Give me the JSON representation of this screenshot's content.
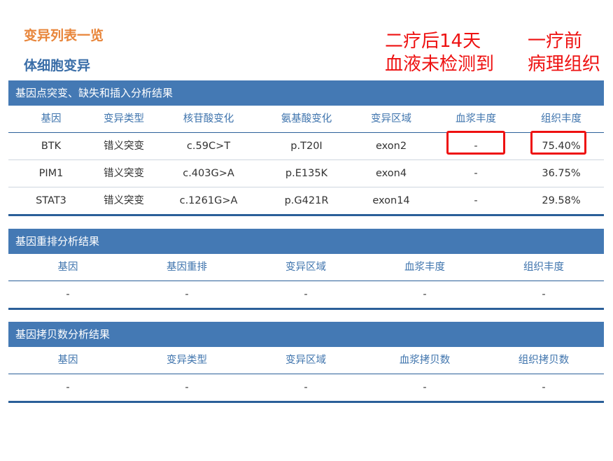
{
  "header": {
    "title": "变异列表一览",
    "subtitle": "体细胞变异"
  },
  "annotations": {
    "left": [
      "二疗后14天",
      "血液未检测到"
    ],
    "right": [
      "一疗前",
      "病理组织"
    ],
    "color": "#ee1111"
  },
  "snv_section": {
    "title": "基因点突变、缺失和插入分析结果",
    "columns": [
      "基因",
      "变异类型",
      "核苷酸变化",
      "氨基酸变化",
      "变异区域",
      "血浆丰度",
      "组织丰度"
    ],
    "rows": [
      [
        "BTK",
        "错义突变",
        "c.59C>T",
        "p.T20I",
        "exon2",
        "-",
        "75.40%"
      ],
      [
        "PIM1",
        "错义突变",
        "c.403G>A",
        "p.E135K",
        "exon4",
        "-",
        "36.75%"
      ],
      [
        "STAT3",
        "错义突变",
        "c.1261G>A",
        "p.G421R",
        "exon14",
        "-",
        "29.58%"
      ]
    ]
  },
  "fusion_section": {
    "title": "基因重排分析结果",
    "columns": [
      "基因",
      "基因重排",
      "变异区域",
      "血浆丰度",
      "组织丰度"
    ],
    "rows": [
      [
        "-",
        "-",
        "-",
        "-",
        "-"
      ]
    ]
  },
  "cnv_section": {
    "title": "基因拷贝数分析结果",
    "columns": [
      "基因",
      "变异类型",
      "变异区域",
      "血浆拷贝数",
      "组织拷贝数"
    ],
    "rows": [
      [
        "-",
        "-",
        "-",
        "-",
        "-"
      ]
    ]
  },
  "colors": {
    "header_bg": "#4479b4",
    "title_orange": "#e8853a",
    "subtitle_blue": "#3a6ea8",
    "column_text": "#3f74ad"
  }
}
